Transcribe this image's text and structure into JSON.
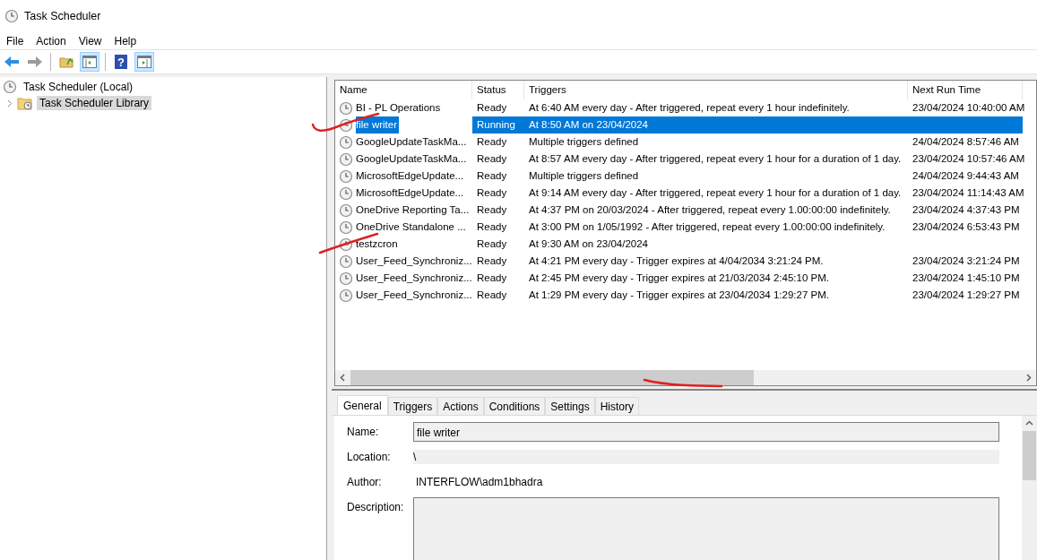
{
  "window": {
    "title": "Task Scheduler"
  },
  "menu": [
    "File",
    "Action",
    "View",
    "Help"
  ],
  "toolbar": [
    {
      "kind": "back",
      "pressed": false,
      "disabled": false
    },
    {
      "kind": "forward",
      "pressed": false,
      "disabled": true
    },
    {
      "kind": "separator"
    },
    {
      "kind": "up",
      "pressed": false,
      "disabled": false
    },
    {
      "kind": "tree",
      "pressed": true,
      "disabled": false
    },
    {
      "kind": "separator"
    },
    {
      "kind": "help",
      "glyph": "?",
      "pressed": false,
      "disabled": false
    },
    {
      "kind": "actionpane",
      "pressed": true,
      "disabled": false
    }
  ],
  "tree": [
    {
      "label": "Task Scheduler (Local)",
      "selected": false,
      "children": [
        {
          "label": "Task Scheduler Library",
          "selected": true,
          "expanded": false
        }
      ]
    }
  ],
  "table": {
    "columns": [
      "Name",
      "Status",
      "Triggers",
      "Next Run Time"
    ],
    "rows": [
      {
        "name": "BI - PL Operations",
        "status": "Ready",
        "triggers": "At 6:40 AM every day - After triggered, repeat every 1 hour indefinitely.",
        "next_run_time": "23/04/2024 10:40:00 AM",
        "selected": false
      },
      {
        "name": "file writer",
        "status": "Running",
        "triggers": "At 8:50 AM on 23/04/2024",
        "selected": true
      },
      {
        "name": "GoogleUpdateTaskMa...",
        "status": "Ready",
        "triggers": "Multiple triggers defined",
        "next_run_time": "24/04/2024 8:57:46 AM",
        "selected": false
      },
      {
        "name": "GoogleUpdateTaskMa...",
        "status": "Ready",
        "triggers": "At 8:57 AM every day - After triggered, repeat every 1 hour for a duration of 1 day.",
        "next_run_time": "23/04/2024 10:57:46 AM",
        "selected": false
      },
      {
        "name": "MicrosoftEdgeUpdate...",
        "status": "Ready",
        "triggers": "Multiple triggers defined",
        "next_run_time": "24/04/2024 9:44:43 AM",
        "selected": false
      },
      {
        "name": "MicrosoftEdgeUpdate...",
        "status": "Ready",
        "triggers": "At 9:14 AM every day - After triggered, repeat every 1 hour for a duration of 1 day.",
        "next_run_time": "23/04/2024 11:14:43 AM",
        "selected": false
      },
      {
        "name": "OneDrive Reporting Ta...",
        "status": "Ready",
        "triggers": "At 4:37 PM on 20/03/2024 - After triggered, repeat every 1.00:00:00 indefinitely.",
        "next_run_time": "23/04/2024 4:37:43 PM",
        "selected": false
      },
      {
        "name": "OneDrive Standalone ...",
        "status": "Ready",
        "triggers": "At 3:00 PM on 1/05/1992 - After triggered, repeat every 1.00:00:00 indefinitely.",
        "next_run_time": "23/04/2024 6:53:43 PM",
        "selected": false
      },
      {
        "name": "testzcron",
        "status": "Ready",
        "triggers": "At 9:30 AM on 23/04/2024",
        "selected": false
      },
      {
        "name": "User_Feed_Synchroniz...",
        "status": "Ready",
        "triggers": "At 4:21 PM every day - Trigger expires at 4/04/2034 3:21:24 PM.",
        "next_run_time": "23/04/2024 3:21:24 PM",
        "selected": false
      },
      {
        "name": "User_Feed_Synchroniz...",
        "status": "Ready",
        "triggers": "At 2:45 PM every day - Trigger expires at 21/03/2034 2:45:10 PM.",
        "next_run_time": "23/04/2024 1:45:10 PM",
        "selected": false
      },
      {
        "name": "User_Feed_Synchroniz...",
        "status": "Ready",
        "triggers": "At 1:29 PM every day - Trigger expires at 23/04/2034 1:29:27 PM.",
        "next_run_time": "23/04/2024 1:29:27 PM",
        "selected": false
      }
    ]
  },
  "detail_tabs": [
    {
      "label": "General",
      "selected": true
    },
    {
      "label": "Triggers",
      "selected": false
    },
    {
      "label": "Actions",
      "selected": false
    },
    {
      "label": "Conditions",
      "selected": false
    },
    {
      "label": "Settings",
      "selected": false
    },
    {
      "label": "History",
      "selected": false
    }
  ],
  "general": [
    {
      "kind": "textbox",
      "label": "Name:",
      "value": "file writer"
    },
    {
      "kind": "readonly",
      "label": "Location:",
      "value": "\\"
    },
    {
      "kind": "text",
      "label": "Author:",
      "value": "INTERFLOW\\adm1bhadra"
    },
    {
      "kind": "textarea",
      "label": "Description:"
    }
  ]
}
